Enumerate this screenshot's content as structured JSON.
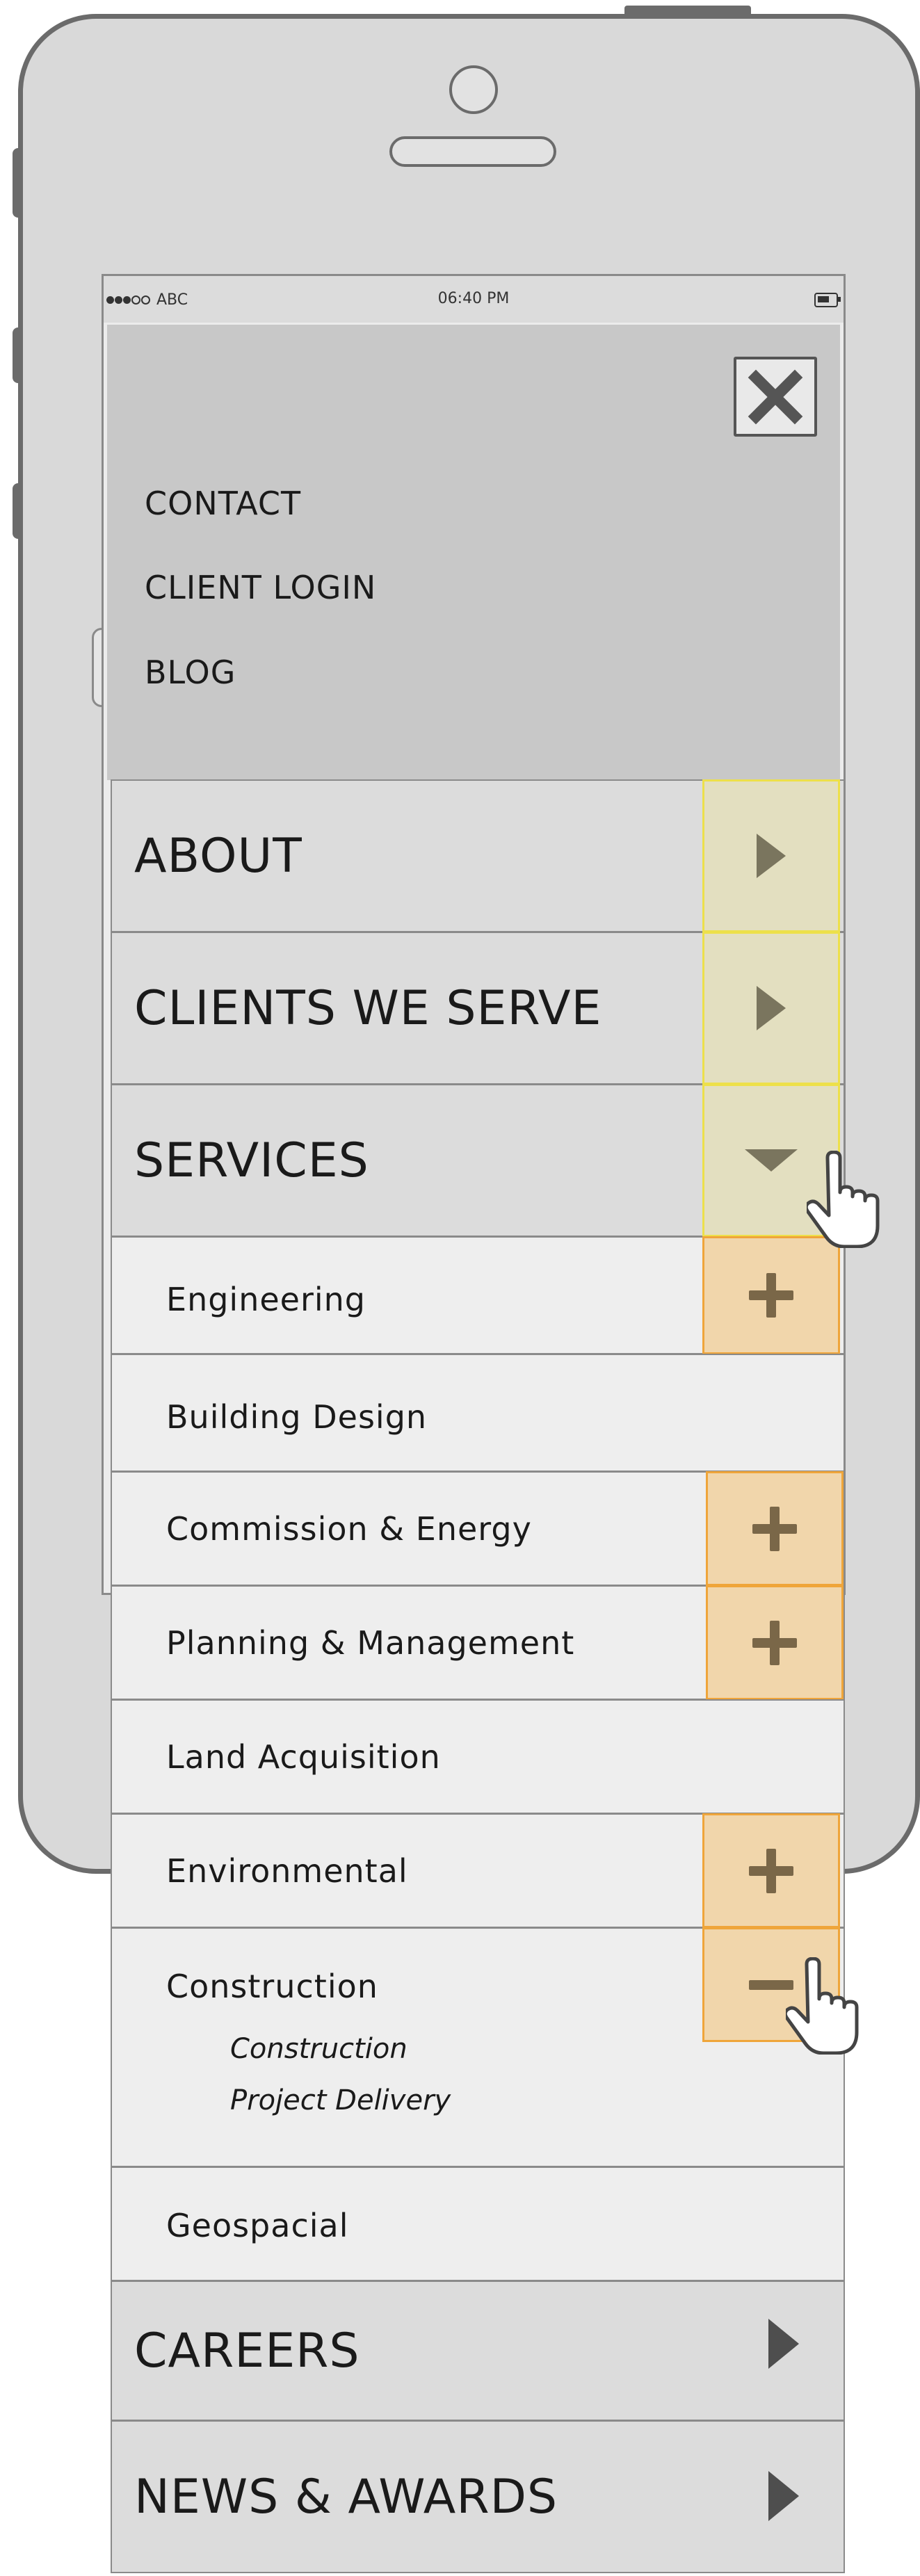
{
  "status_bar": {
    "carrier": "ABC",
    "time": "06:40 PM",
    "signal_icon": "signal-dots-icon",
    "battery_icon": "battery-icon"
  },
  "top_menu": {
    "close_icon": "close-x-icon",
    "links": [
      {
        "label": "CONTACT"
      },
      {
        "label": "CLIENT LOGIN"
      },
      {
        "label": "BLOG"
      }
    ]
  },
  "nav": {
    "about": {
      "label": "ABOUT",
      "icon": "chevron-right-icon"
    },
    "clients": {
      "label": "CLIENTS WE SERVE",
      "icon": "chevron-right-icon"
    },
    "services": {
      "label": "SERVICES",
      "icon": "chevron-down-icon",
      "expanded": true,
      "items": [
        {
          "label": "Engineering",
          "toggle": "plus"
        },
        {
          "label": "Building Design"
        },
        {
          "label": "Commission & Energy",
          "toggle": "plus"
        },
        {
          "label": "Planning & Management",
          "toggle": "plus"
        },
        {
          "label": "Land Acquisition"
        },
        {
          "label": "Environmental",
          "toggle": "plus"
        },
        {
          "label": "Construction",
          "toggle": "minus",
          "expanded": true,
          "children": [
            {
              "label": "Construction"
            },
            {
              "label": "Project Delivery"
            }
          ]
        },
        {
          "label": "Geospacial"
        }
      ]
    },
    "careers": {
      "label": "CAREERS",
      "icon": "chevron-right-icon"
    },
    "news": {
      "label": "NEWS & AWARDS",
      "icon": "chevron-right-icon"
    }
  },
  "colors": {
    "phone_body": "#d9d9d9",
    "phone_outline": "#6b6b6b",
    "menu_gray": "#c8c8c8",
    "row_gray": "#dcdcdc",
    "sub_row": "#eeeeee",
    "highlight_yellow": "#ede04a",
    "highlight_orange": "#efa53a"
  },
  "cursor_icons": [
    "hand-pointer-icon",
    "hand-pointer-icon"
  ]
}
